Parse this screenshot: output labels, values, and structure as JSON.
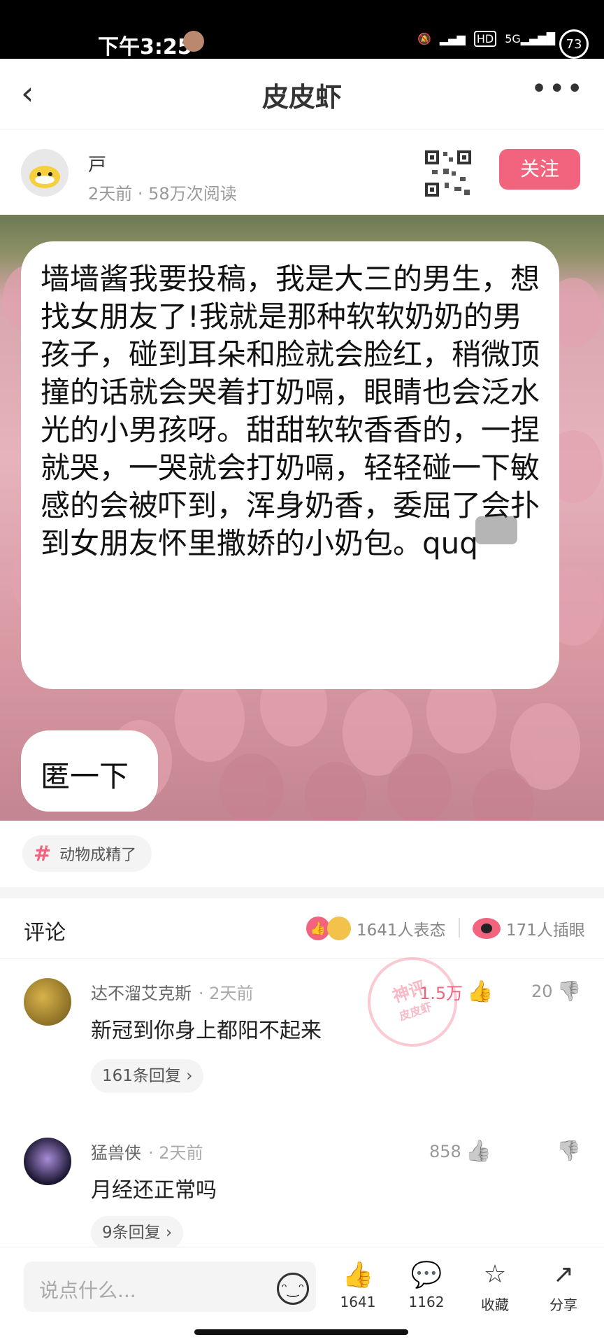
{
  "status_bar": {
    "time": "下午3:25",
    "battery": "73"
  },
  "nav": {
    "title": "皮皮虾"
  },
  "author": {
    "name": "戸",
    "meta": "2天前 · 58万次阅读",
    "follow_label": "关注"
  },
  "post": {
    "bubble_text": "墙墙酱我要投稿，我是大三的男生，想找女朋友了!我就是那种软软奶奶的男孩子，碰到耳朵和脸就会脸红，稍微顶撞的话就会哭着打奶嗝，眼睛也会泛水光的小男孩呀。甜甜软软香香的，一捏就哭，一哭就会打奶嗝，轻轻碰一下敏感的会被吓到，浑身奶香，委屈了会扑到女朋友怀里撒娇的小奶包。quq",
    "reply_text": "匿一下",
    "tag": "动物成精了"
  },
  "comments_header": {
    "title": "评论",
    "reactions": "1641人表态",
    "eyes": "171人插眼"
  },
  "comments": [
    {
      "name": "达不溜艾克斯",
      "time": "· 2天前",
      "text": "新冠到你身上都阳不起来",
      "likes": "1.5万",
      "dislikes": "20",
      "replies": "161条回复 ›"
    },
    {
      "name": "猛兽侠",
      "time": "· 2天前",
      "text": "月经还正常吗",
      "likes": "858",
      "dislikes": "",
      "replies": "9条回复 ›"
    }
  ],
  "stamp": {
    "line1": "神评",
    "line2": "皮皮虾"
  },
  "bottom_bar": {
    "input_placeholder": "说点什么...",
    "like_count": "1641",
    "comment_count": "1162",
    "favorite_label": "收藏",
    "share_label": "分享"
  }
}
